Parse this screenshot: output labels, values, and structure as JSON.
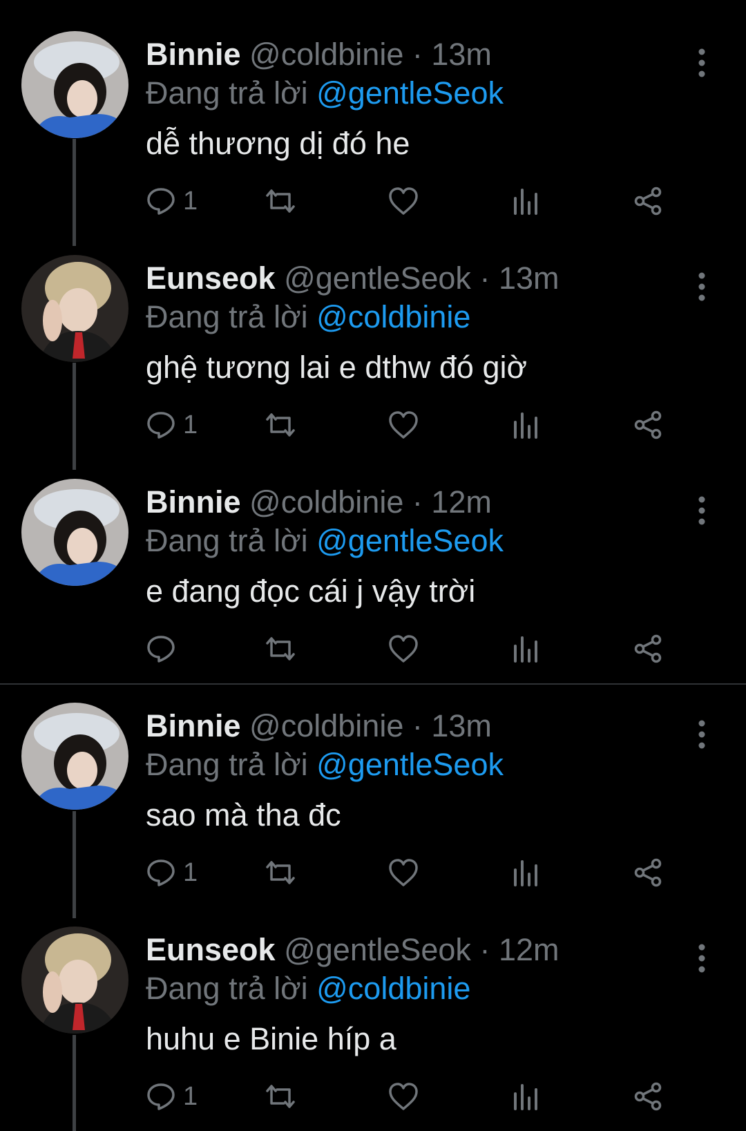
{
  "reply_label": "Đang trả lời",
  "tweets": [
    {
      "name": "Binnie",
      "handle": "@coldbinie",
      "dot": "·",
      "time": "13m",
      "replying_to": "@gentleSeok",
      "text": "dễ thương dị đó he",
      "reply_count": "1",
      "avatar": "binnie"
    },
    {
      "name": "Eunseok",
      "handle": "@gentleSeok",
      "dot": "·",
      "time": "13m",
      "replying_to": "@coldbinie",
      "text": "ghệ tương lai e dthw đó giờ",
      "reply_count": "1",
      "avatar": "eunseok"
    },
    {
      "name": "Binnie",
      "handle": "@coldbinie",
      "dot": "·",
      "time": "12m",
      "replying_to": "@gentleSeok",
      "text": "e đang đọc cái j vậy trời",
      "reply_count": "",
      "avatar": "binnie"
    },
    {
      "name": "Binnie",
      "handle": "@coldbinie",
      "dot": "·",
      "time": "13m",
      "replying_to": "@gentleSeok",
      "text": "sao mà tha đc",
      "reply_count": "1",
      "avatar": "binnie"
    },
    {
      "name": "Eunseok",
      "handle": "@gentleSeok",
      "dot": "·",
      "time": "12m",
      "replying_to": "@coldbinie",
      "text": "huhu e Binie híp a",
      "reply_count": "1",
      "avatar": "eunseok"
    }
  ],
  "icons": {
    "reply": "reply-icon",
    "retweet": "retweet-icon",
    "like": "heart-icon",
    "views": "views-icon",
    "share": "share-icon",
    "more": "more-vertical-icon"
  },
  "colors": {
    "background": "#000000",
    "text": "#e7e9ea",
    "muted": "#71767b",
    "link": "#1d9bf0",
    "divider": "#2f3336"
  }
}
